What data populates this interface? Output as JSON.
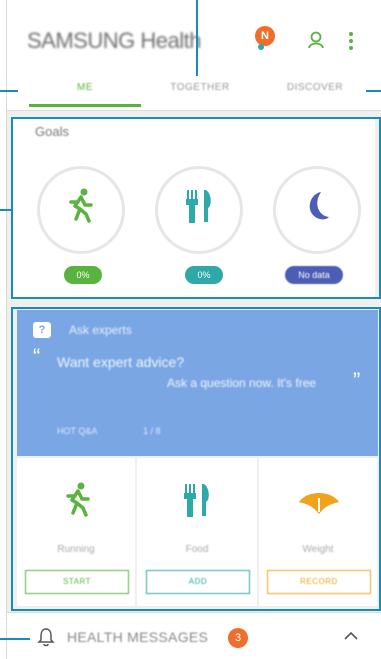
{
  "header": {
    "logo_text": "SAMSUNG Health",
    "notification_badge": "N"
  },
  "tabs": [
    {
      "label": "ME",
      "active": true
    },
    {
      "label": "TOGETHER",
      "active": false
    },
    {
      "label": "DISCOVER",
      "active": false
    }
  ],
  "goals": {
    "title": "Goals",
    "items": [
      {
        "icon": "running-icon",
        "value": "0%",
        "color": "#59b33f"
      },
      {
        "icon": "food-icon",
        "value": "0%",
        "color": "#2ea8a8"
      },
      {
        "icon": "sleep-icon",
        "value": "No data",
        "color": "#4b5db5"
      }
    ]
  },
  "experts": {
    "title": "Ask experts",
    "line1": "Want expert advice?",
    "line2": "Ask a question now. It's free",
    "footer": "HOT Q&A",
    "page": "1 / 8"
  },
  "trackers": [
    {
      "label": "Running",
      "button": "START",
      "color": "#59b33f"
    },
    {
      "label": "Food",
      "button": "ADD",
      "color": "#2ea8a8"
    },
    {
      "label": "Weight",
      "button": "RECORD",
      "color": "#f0a21b"
    }
  ],
  "messages": {
    "label": "HEALTH MESSAGES",
    "count": "3"
  },
  "colors": {
    "accent_green": "#59b33f",
    "callout_blue": "#1a8bb8"
  }
}
